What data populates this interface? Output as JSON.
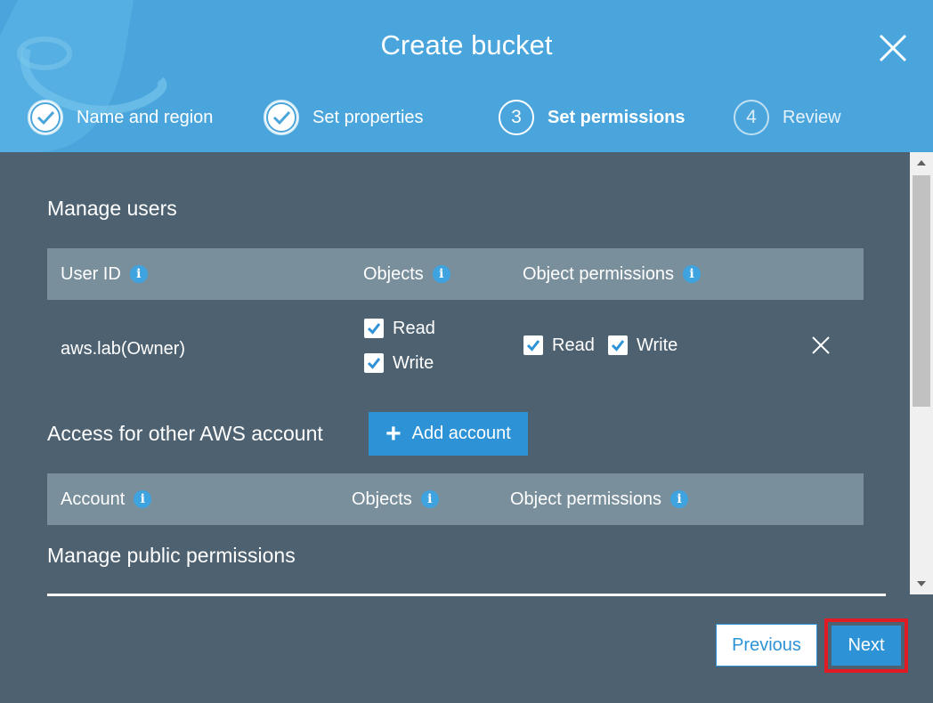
{
  "dialog": {
    "title": "Create bucket"
  },
  "steps": [
    {
      "number": "1",
      "label": "Name and region",
      "state": "done"
    },
    {
      "number": "2",
      "label": "Set properties",
      "state": "done"
    },
    {
      "number": "3",
      "label": "Set permissions",
      "state": "current"
    },
    {
      "number": "4",
      "label": "Review",
      "state": "future"
    }
  ],
  "manage_users": {
    "heading": "Manage users",
    "columns": [
      "User ID",
      "Objects",
      "Object permissions"
    ],
    "rows": [
      {
        "user_id": "aws.lab(Owner)",
        "objects": [
          {
            "label": "Read",
            "checked": true
          },
          {
            "label": "Write",
            "checked": true
          }
        ],
        "object_permissions": [
          {
            "label": "Read",
            "checked": true
          },
          {
            "label": "Write",
            "checked": true
          }
        ]
      }
    ]
  },
  "other_accounts": {
    "heading": "Access for other AWS account",
    "add_button": "Add account",
    "columns": [
      "Account",
      "Objects",
      "Object permissions"
    ]
  },
  "public_permissions": {
    "heading": "Manage public permissions"
  },
  "footer": {
    "previous_label": "Previous",
    "next_label": "Next"
  },
  "colors": {
    "header_bg": "#4aa5dc",
    "body_bg": "#4d6170",
    "table_header_bg": "#7a8f9c",
    "accent": "#2d93d6",
    "highlight_border": "#e01b24"
  },
  "icons": {
    "close": "close-icon",
    "info": "info-icon",
    "check": "check-icon",
    "remove": "remove-icon",
    "plus": "plus-icon"
  }
}
